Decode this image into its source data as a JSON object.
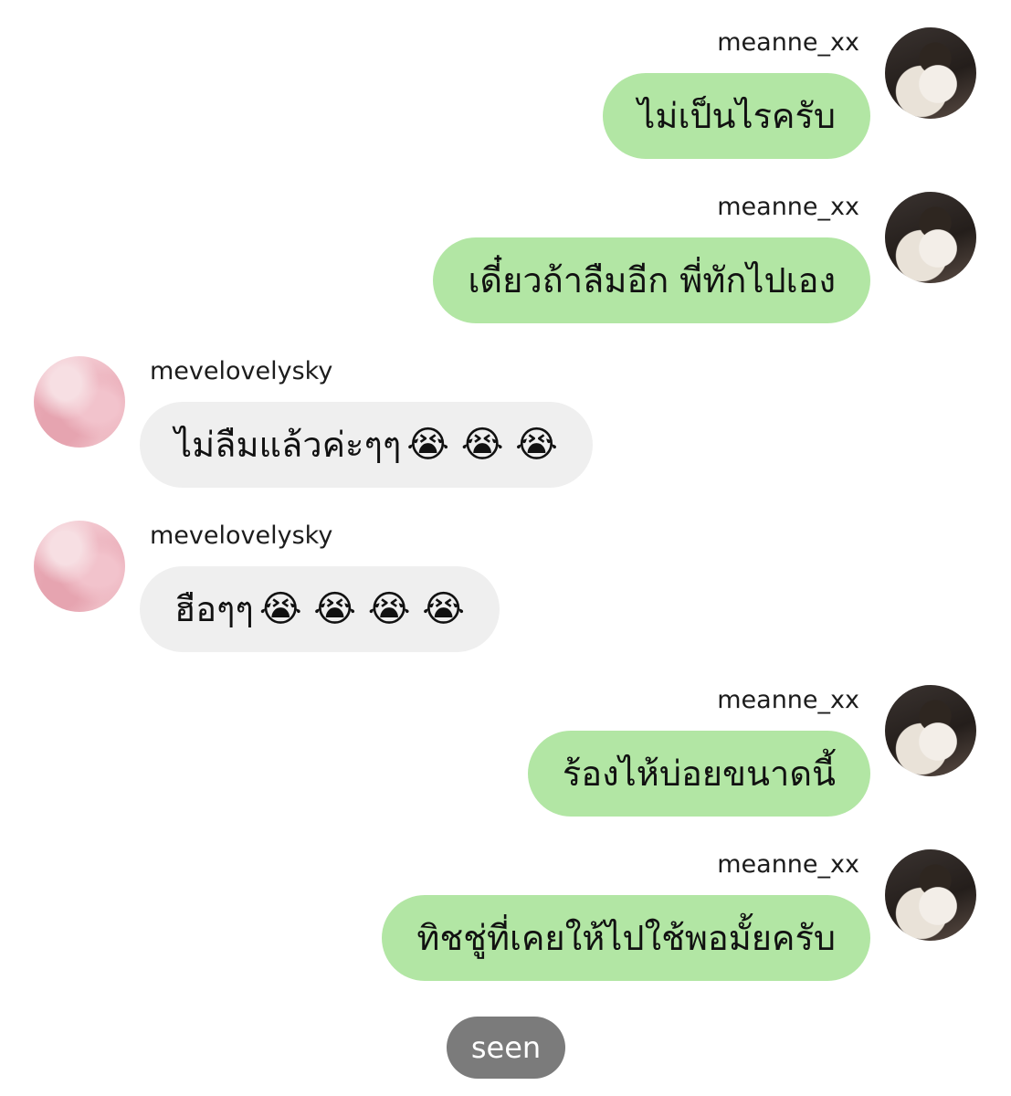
{
  "messages": [
    {
      "side": "right",
      "username": "meanne_xx",
      "text": "ไม่เป็นไรครับ",
      "avatar": "dark"
    },
    {
      "side": "right",
      "username": "meanne_xx",
      "text": "เดี๋ยวถ้าลืมอีก พี่ทักไปเอง",
      "avatar": "dark"
    },
    {
      "side": "left",
      "username": "mevelovelysky",
      "text": "ไม่ลืมแล้วค่ะๆๆ",
      "emoji": "😭 😭 😭",
      "avatar": "pink"
    },
    {
      "side": "left",
      "username": "mevelovelysky",
      "text": "ฮือๆๆ",
      "emoji": "😭 😭 😭 😭",
      "avatar": "pink"
    },
    {
      "side": "right",
      "username": "meanne_xx",
      "text": "ร้องไห้บ่อยขนาดนี้",
      "avatar": "dark"
    },
    {
      "side": "right",
      "username": "meanne_xx",
      "text": "ทิชชู่ที่เคยให้ไปใช้พอมั้ยครับ",
      "avatar": "dark"
    }
  ],
  "status": {
    "seen_label": "seen"
  },
  "colors": {
    "sent_bubble": "#b2e6a4",
    "received_bubble": "#efefef",
    "seen_pill": "#7b7b7b"
  }
}
